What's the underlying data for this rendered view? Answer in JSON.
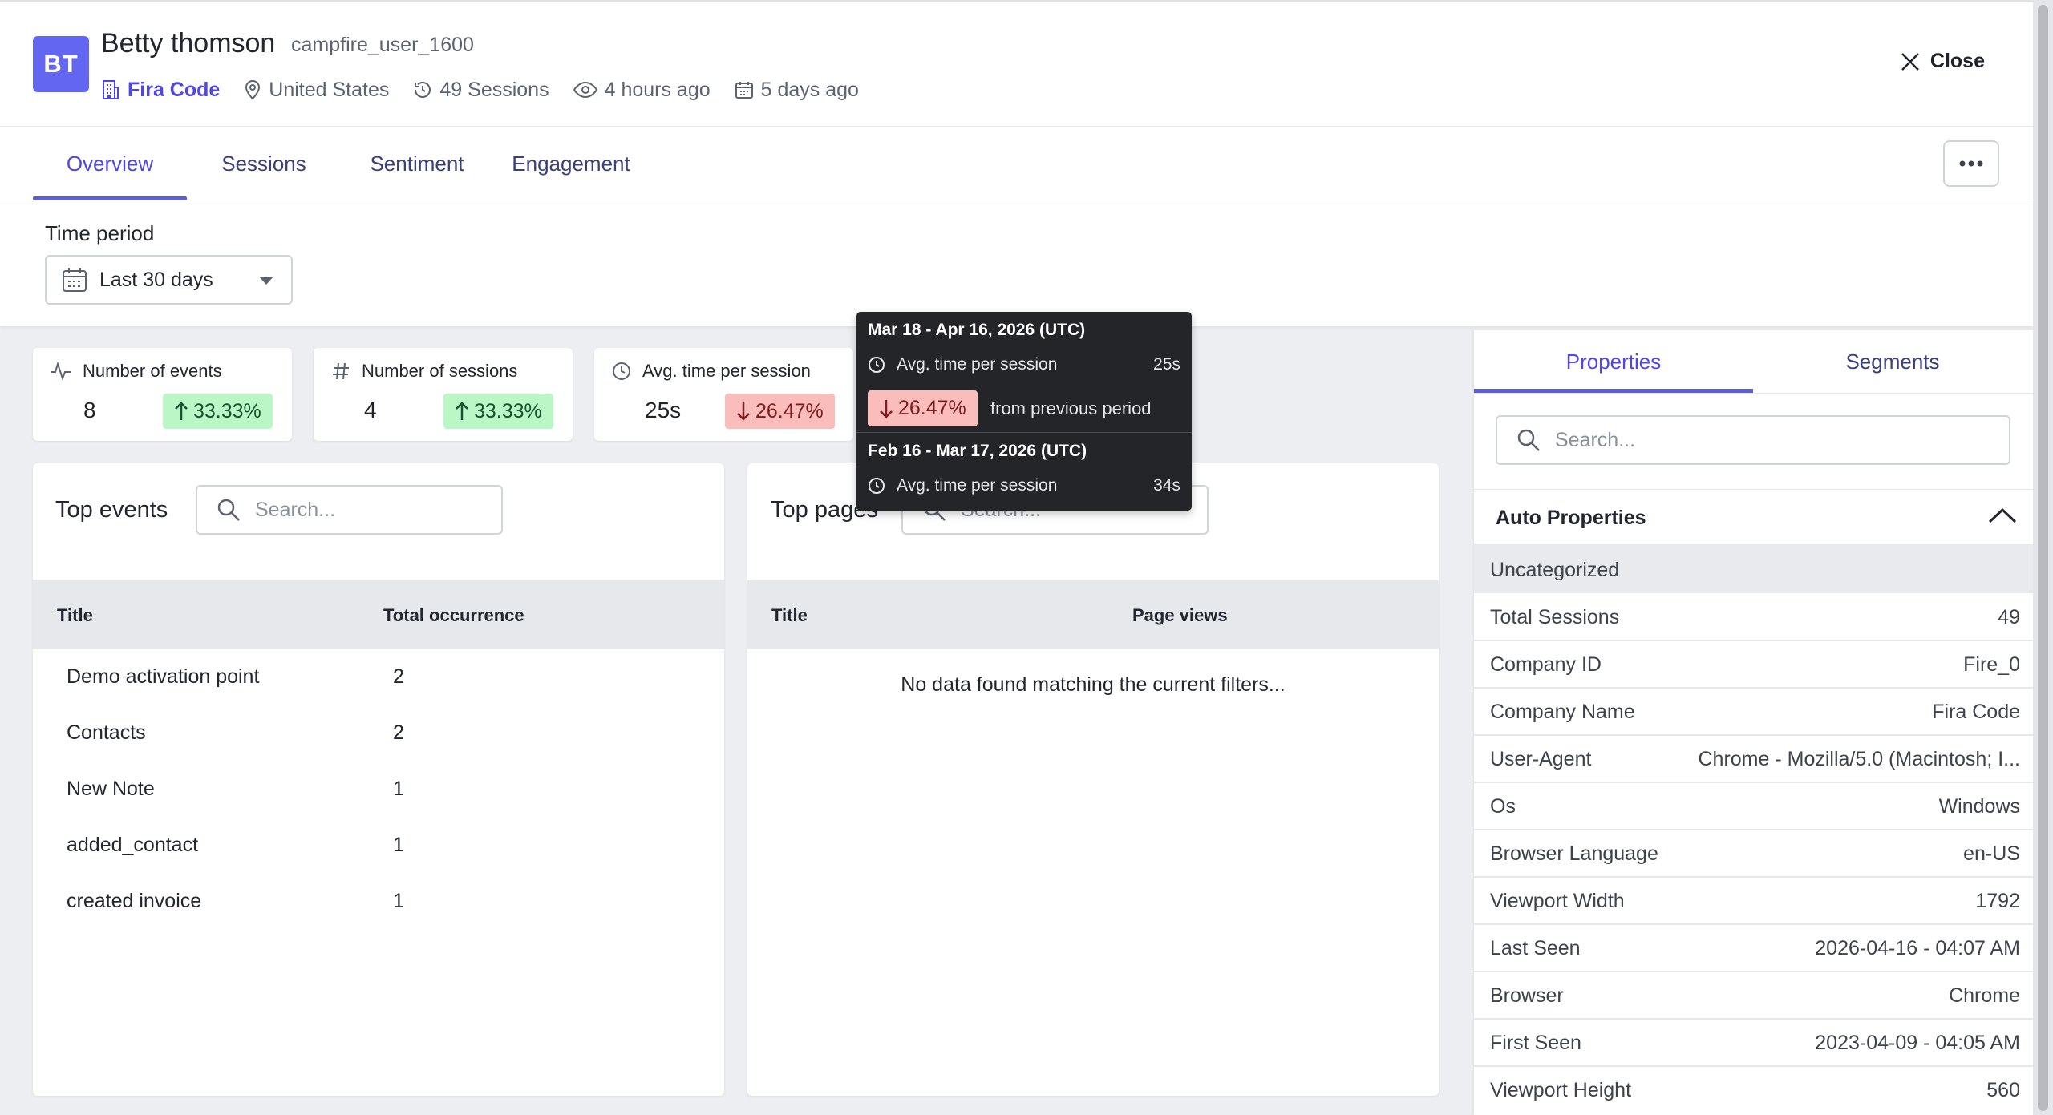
{
  "user": {
    "initials": "BT",
    "name": "Betty thomson",
    "id": "campfire_user_1600",
    "company": "Fira Code",
    "location": "United States",
    "sessions": "49 Sessions",
    "last_seen": "4 hours ago",
    "created": "5 days ago"
  },
  "header": {
    "close_label": "Close"
  },
  "tabs": [
    {
      "label": "Overview"
    },
    {
      "label": "Sessions"
    },
    {
      "label": "Sentiment"
    },
    {
      "label": "Engagement"
    }
  ],
  "time_period": {
    "label": "Time period",
    "value": "Last 30 days"
  },
  "stats": [
    {
      "label": "Number of events",
      "value": "8",
      "change": "33.33%",
      "direction": "up"
    },
    {
      "label": "Number of sessions",
      "value": "4",
      "change": "33.33%",
      "direction": "up"
    },
    {
      "label": "Avg. time per session",
      "value": "25s",
      "change": "26.47%",
      "direction": "down"
    }
  ],
  "tooltip": {
    "current_period": "Mar 18 - Apr 16, 2026 (UTC)",
    "current_label": "Avg. time per session",
    "current_value": "25s",
    "change": "26.47%",
    "change_text": "from previous period",
    "previous_period": "Feb 16 - Mar 17, 2026 (UTC)",
    "previous_label": "Avg. time per session",
    "previous_value": "34s"
  },
  "top_events": {
    "title": "Top events",
    "search_placeholder": "Search...",
    "columns": [
      "Title",
      "Total occurrence"
    ],
    "rows": [
      {
        "title": "Demo activation point",
        "count": "2"
      },
      {
        "title": "Contacts",
        "count": "2"
      },
      {
        "title": "New Note",
        "count": "1"
      },
      {
        "title": "added_contact",
        "count": "1"
      },
      {
        "title": "created invoice",
        "count": "1"
      }
    ]
  },
  "top_pages": {
    "title": "Top pages",
    "search_placeholder": "Search...",
    "columns": [
      "Title",
      "Page views"
    ],
    "empty_text": "No data found matching the current filters..."
  },
  "properties_panel": {
    "tabs": [
      {
        "label": "Properties"
      },
      {
        "label": "Segments"
      }
    ],
    "search_placeholder": "Search...",
    "section_title": "Auto Properties",
    "category": "Uncategorized",
    "rows": [
      {
        "key": "Total Sessions",
        "value": "49"
      },
      {
        "key": "Company ID",
        "value": "Fire_0"
      },
      {
        "key": "Company Name",
        "value": "Fira Code"
      },
      {
        "key": "User-Agent",
        "value": "Chrome - Mozilla/5.0 (Macintosh; I..."
      },
      {
        "key": "Os",
        "value": "Windows"
      },
      {
        "key": "Browser Language",
        "value": "en-US"
      },
      {
        "key": "Viewport Width",
        "value": "1792"
      },
      {
        "key": "Last Seen",
        "value": "2026-04-16 - 04:07 AM"
      },
      {
        "key": "Browser",
        "value": "Chrome"
      },
      {
        "key": "First Seen",
        "value": "2023-04-09 - 04:05 AM"
      },
      {
        "key": "Viewport Height",
        "value": "560"
      }
    ]
  },
  "colors": {
    "accent": "#4f46e5",
    "avatar_bg": "#6366f1",
    "positive_bg": "#bbf7c6",
    "negative_bg": "#fbbcbc",
    "tooltip_bg": "#242528"
  }
}
